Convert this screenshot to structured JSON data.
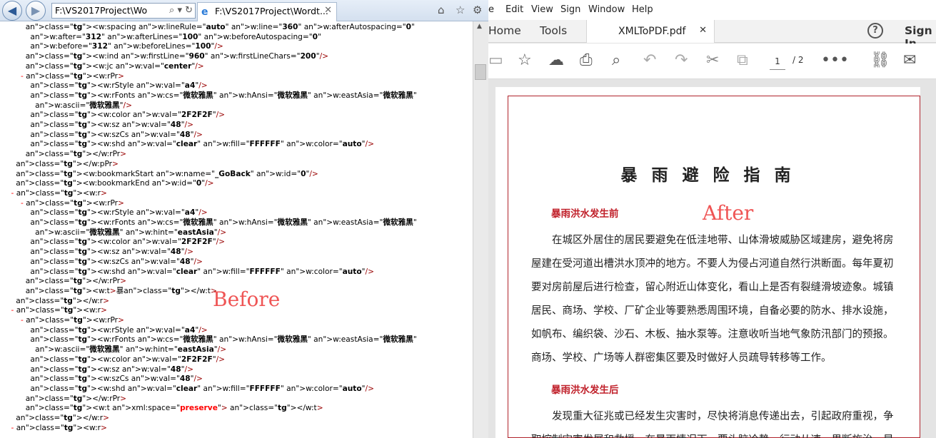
{
  "ie": {
    "address": "F:\\VS2017Project\\Wo",
    "address_controls": "⌕ ▾ ↻",
    "tab_title": "F:\\VS2017Project\\Wordt...",
    "xml_lines": [
      "          <w:spacing w:lineRule=\"auto\" w:line=\"360\" w:afterAutospacing=\"0\"",
      "            w:after=\"312\" w:afterLines=\"100\" w:beforeAutospacing=\"0\"",
      "            w:before=\"312\" w:beforeLines=\"100\"/>",
      "          <w:ind w:firstLine=\"960\" w:firstLineChars=\"200\"/>",
      "          <w:jc w:val=\"center\"/>",
      "        - <w:rPr>",
      "            <w:rStyle w:val=\"a4\"/>",
      "            <w:rFonts w:cs=\"微软雅黑\" w:hAnsi=\"微软雅黑\" w:eastAsia=\"微软雅黑\"",
      "              w:ascii=\"微软雅黑\"/>",
      "            <w:color w:val=\"2F2F2F\"/>",
      "            <w:sz w:val=\"48\"/>",
      "            <w:szCs w:val=\"48\"/>",
      "            <w:shd w:val=\"clear\" w:fill=\"FFFFFF\" w:color=\"auto\"/>",
      "          </w:rPr>",
      "      </w:pPr>",
      "      <w:bookmarkStart w:name=\"_GoBack\" w:id=\"0\"/>",
      "      <w:bookmarkEnd w:id=\"0\"/>",
      "    - <w:r>",
      "        - <w:rPr>",
      "            <w:rStyle w:val=\"a4\"/>",
      "            <w:rFonts w:cs=\"微软雅黑\" w:hAnsi=\"微软雅黑\" w:eastAsia=\"微软雅黑\"",
      "              w:ascii=\"微软雅黑\" w:hint=\"eastAsia\"/>",
      "            <w:color w:val=\"2F2F2F\"/>",
      "            <w:sz w:val=\"48\"/>",
      "            <w:szCs w:val=\"48\"/>",
      "            <w:shd w:val=\"clear\" w:fill=\"FFFFFF\" w:color=\"auto\"/>",
      "          </w:rPr>",
      "          <w:t>暴</w:t>",
      "      </w:r>",
      "    - <w:r>",
      "        - <w:rPr>",
      "            <w:rStyle w:val=\"a4\"/>",
      "            <w:rFonts w:cs=\"微软雅黑\" w:hAnsi=\"微软雅黑\" w:eastAsia=\"微软雅黑\"",
      "              w:ascii=\"微软雅黑\" w:hint=\"eastAsia\"/>",
      "            <w:color w:val=\"2F2F2F\"/>",
      "            <w:sz w:val=\"48\"/>",
      "            <w:szCs w:val=\"48\"/>",
      "            <w:shd w:val=\"clear\" w:fill=\"FFFFFF\" w:color=\"auto\"/>",
      "          </w:rPr>",
      "          <w:t xml:space=\"preserve\"> </w:t>",
      "      </w:r>",
      "    - <w:r>"
    ],
    "before_label": "Before"
  },
  "reader": {
    "menu": [
      "e",
      "Edit",
      "View",
      "Sign",
      "Window",
      "Help"
    ],
    "tabs": {
      "home": "Home",
      "tools": "Tools",
      "document": "XMLToPDF.pdf"
    },
    "sign_in": "Sign In",
    "page_current": "1",
    "page_total": "/ 2",
    "pdf": {
      "title": "暴 雨 避 险 指 南",
      "heading_before": "暴雨洪水发生前",
      "para_before": [
        "　　在城区外居住的居民要避免在低洼地带、山体滑坡威胁区域建房，避免将房",
        "屋建在受河道出槽洪水顶冲的地方。不要人为侵占河道自然行洪断面。每年夏初",
        "要对房前屋后进行检查，留心附近山体变化，看山上是否有裂缝滑坡迹象。城镇",
        "居民、商场、学校、厂矿企业等要熟悉周围环境，自备必要的防水、排水设施，",
        "如帆布、编织袋、沙石、木板、抽水泵等。注意收听当地气象防汛部门的预报。",
        "商场、学校、广场等人群密集区要及时做好人员疏导转移等工作。"
      ],
      "heading_after": "暴雨洪水发生后",
      "para_after": [
        "　　发现重大征兆或已经发生灾害时，尽快将消息传递出去，引起政府重视，争",
        "取控制灾害发展和救援。在暴雨情况下，要头脑冷静，行动从速，果断施治，是"
      ]
    },
    "after_label": "After"
  }
}
